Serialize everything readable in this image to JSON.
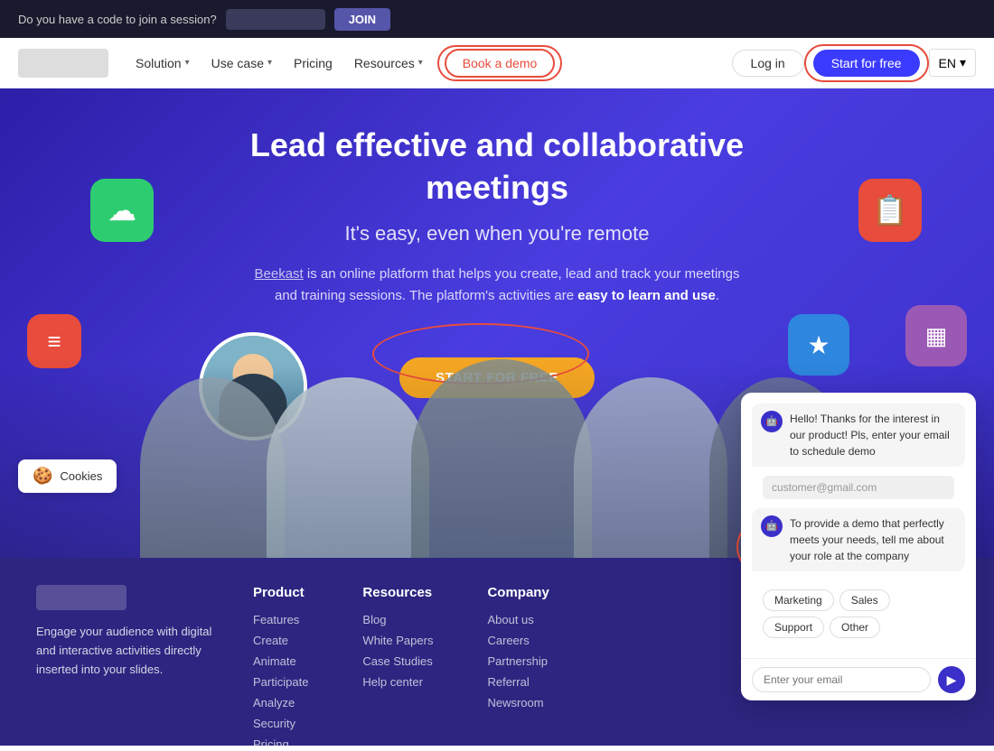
{
  "topbar": {
    "code_label": "Do you have a code to join a session?",
    "input_placeholder": "",
    "join_button": "JOIN"
  },
  "navbar": {
    "solution_label": "Solution",
    "usecase_label": "Use case",
    "pricing_label": "Pricing",
    "resources_label": "Resources",
    "bookdemo_label": "Book a demo",
    "login_label": "Log in",
    "startfree_label": "Start for free",
    "lang_label": "EN"
  },
  "hero": {
    "headline": "Lead effective and collaborative meetings",
    "subheadline": "It's easy, even when you're remote",
    "description_prefix": " is an online platform that helps you create, lead and track your meetings and training sessions.",
    "description_suffix": " The platform's activities are ",
    "description_bold": "easy to learn and use",
    "cta_button": "START FOR FREE",
    "brand_name": "Beekast"
  },
  "footer": {
    "tagline": "Engage your audience with digital and interactive activities directly inserted into your slides.",
    "product": {
      "heading": "Product",
      "links": [
        "Features",
        "Create",
        "Animate",
        "Participate",
        "Analyze",
        "Security",
        "Pricing"
      ]
    },
    "resources": {
      "heading": "Resources",
      "links": [
        "Blog",
        "White Papers",
        "Case Studies",
        "Help center"
      ]
    },
    "company": {
      "heading": "Company",
      "links": [
        "About us",
        "Careers",
        "Partnership",
        "Referral",
        "Newsroom"
      ]
    }
  },
  "chat": {
    "bot_msg1": "Hello! Thanks for the interest in our product! Pls, enter your email to schedule demo",
    "email_placeholder": "customer@gmail.com",
    "bot_msg2": "To provide a demo that perfectly meets your needs, tell me about your role at the company",
    "role_buttons": [
      "Marketing",
      "Sales",
      "Support",
      "Other"
    ],
    "input_placeholder": "Enter your email"
  },
  "cookies": {
    "label": "Cookies"
  },
  "icons": {
    "cloud": "☁",
    "board": "📋",
    "list": "≡",
    "star": "★",
    "table": "▦"
  }
}
